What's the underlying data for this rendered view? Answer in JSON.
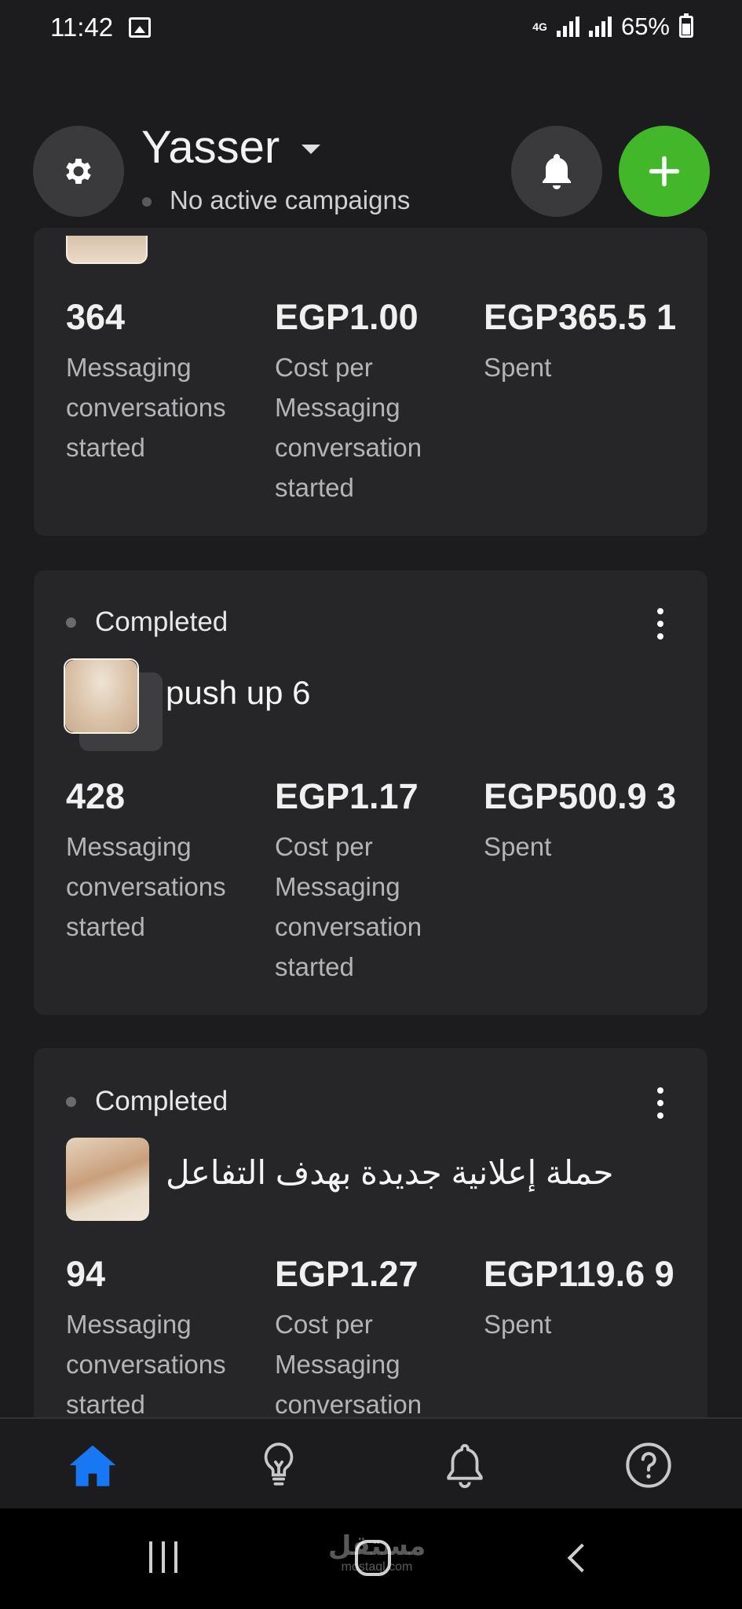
{
  "status_bar": {
    "time": "11:42",
    "network": "4G",
    "battery": "65%",
    "battery_level": 0.65
  },
  "header": {
    "account_name": "Yasser",
    "account_status": "No active campaigns",
    "icons": [
      "gear-icon",
      "bell-icon",
      "plus-icon"
    ]
  },
  "campaigns": [
    {
      "metrics": [
        {
          "value": "364",
          "label": "Messaging conversations started"
        },
        {
          "value": "EGP1.00",
          "label": "Cost per Messaging conversation started"
        },
        {
          "value": "EGP365.5 1",
          "label": "Spent"
        }
      ]
    },
    {
      "status": "Completed",
      "name": "push up 6",
      "metrics": [
        {
          "value": "428",
          "label": "Messaging conversations started"
        },
        {
          "value": "EGP1.17",
          "label": "Cost per Messaging conversation started"
        },
        {
          "value": "EGP500.9 3",
          "label": "Spent"
        }
      ]
    },
    {
      "status": "Completed",
      "name": "حملة إعلانية جديدة بهدف التفاعل",
      "metrics": [
        {
          "value": "94",
          "label": "Messaging conversations started"
        },
        {
          "value": "EGP1.27",
          "label": "Cost per Messaging conversation started"
        },
        {
          "value": "EGP119.6 9",
          "label": "Spent"
        }
      ]
    }
  ],
  "bottom_nav": {
    "items": [
      "home-icon",
      "lightbulb-icon",
      "bell-icon",
      "help-icon"
    ],
    "active": "home",
    "active_color": "#1877f2"
  },
  "watermark": {
    "arabic": "مستقل",
    "latin": "mostaql.com"
  },
  "colors": {
    "background": "#1c1c1e",
    "card": "#262628",
    "accent_green": "#42b72a",
    "active_blue": "#1877f2"
  }
}
